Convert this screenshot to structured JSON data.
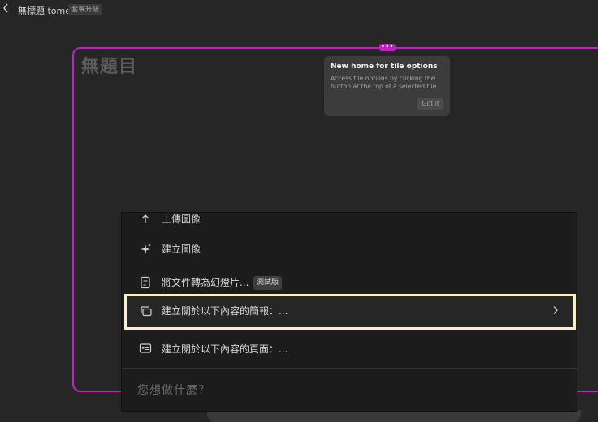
{
  "topbar": {
    "back_icon": "chevron-left-icon",
    "doc_title": "無標題 tome",
    "plan_badge": "套餐升級"
  },
  "tile": {
    "heading": "無題目",
    "accent_color": "#c11fc7",
    "handle_icon": "more-horizontal-icon",
    "handle_label": "•••"
  },
  "tooltip": {
    "title": "New home for tile options",
    "body": "Access tile options by clicking the button at the top of a selected tile",
    "button": "Got it"
  },
  "menu": {
    "items": [
      {
        "icon": "upload-icon",
        "label": "上傳圖像"
      },
      {
        "icon": "sparkle-icon",
        "label": "建立圖像"
      },
      {
        "icon": "document-icon",
        "label": "將文件轉為幻燈片...",
        "badge": "測試版"
      },
      {
        "icon": "slides-icon",
        "label": "建立關於以下內容的簡報：...",
        "selected": true,
        "trailing_icon": "chevron-right-icon"
      },
      {
        "icon": "page-card-icon",
        "label": "建立關於以下內容的頁面：..."
      }
    ],
    "prompt_placeholder": "您想做什麼？",
    "selection_outline_color": "#fbeec7"
  }
}
